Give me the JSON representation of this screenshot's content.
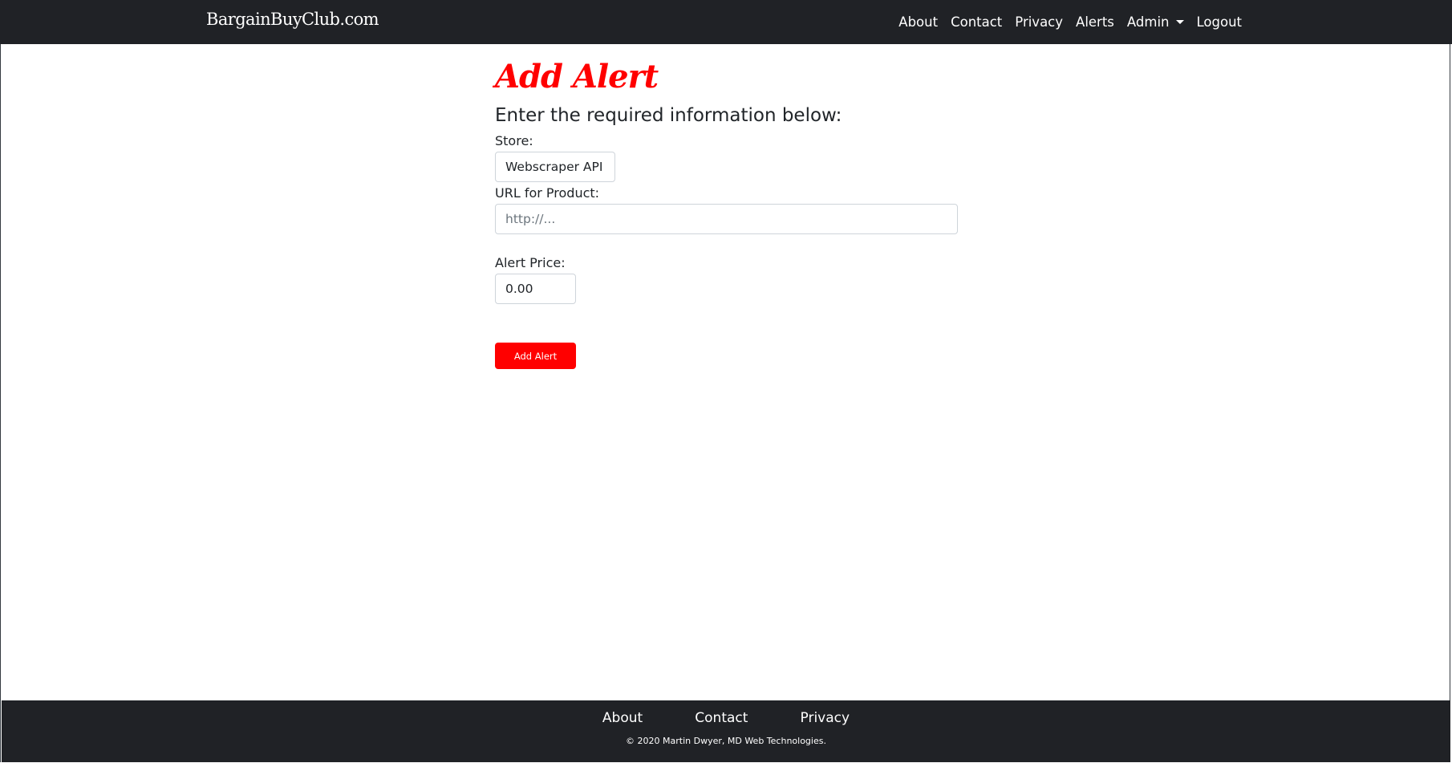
{
  "nav": {
    "brand": "BargainBuyClub.com",
    "links": {
      "about": "About",
      "contact": "Contact",
      "privacy": "Privacy",
      "alerts": "Alerts",
      "admin": "Admin",
      "logout": "Logout"
    }
  },
  "form": {
    "title": "Add Alert",
    "subtitle": "Enter the required information below:",
    "store_label": "Store:",
    "store_value": "Webscraper API",
    "url_label": "URL for Product:",
    "url_placeholder": "http://...",
    "price_label": "Alert Price:",
    "price_value": "0.00",
    "submit_label": "Add Alert"
  },
  "footer": {
    "links": {
      "about": "About",
      "contact": "Contact",
      "privacy": "Privacy"
    },
    "copyright": "© 2020 Martin Dwyer, MD Web Technologies."
  },
  "colors": {
    "navbar_bg": "#202226",
    "accent": "#ff0000"
  }
}
